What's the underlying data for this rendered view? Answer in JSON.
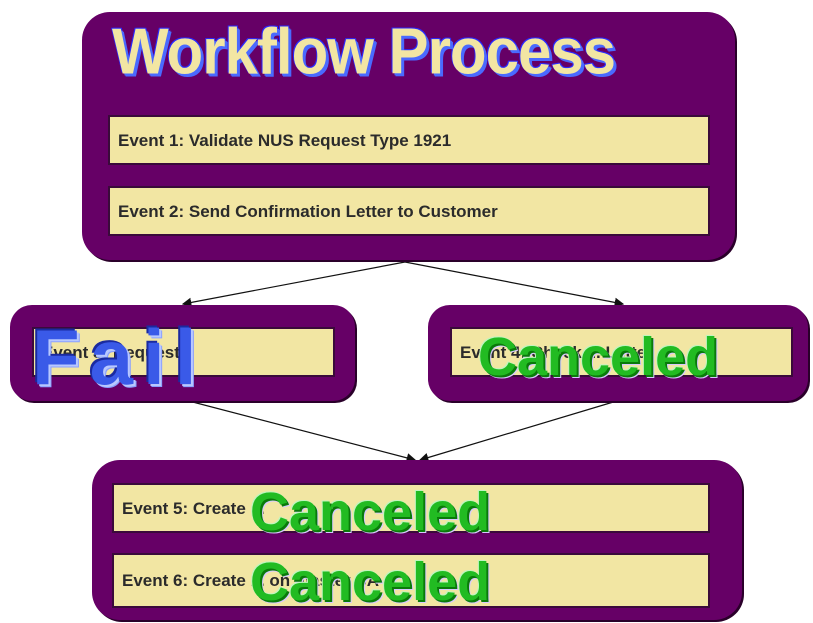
{
  "title": "Workflow Process",
  "events": {
    "e1": "Event 1: Validate NUS Request Type 1921",
    "e2": "Event 2: Send Confirmation Letter to Customer",
    "e3": "Event 3: Request",
    "e4": "Event 4: Check ... Letter",
    "e5": "Event 5: Create ...",
    "e6": "Event 6: Create ... on master SA"
  },
  "stamps": {
    "fail": "Fail",
    "canceled_e4": "Canceled",
    "canceled_e5": "Canceled",
    "canceled_e6": "Canceled"
  },
  "colors": {
    "container": "#660066",
    "event_fill": "#f2e6a3",
    "fail": "#3a5ae8",
    "canceled": "#22bb22"
  }
}
